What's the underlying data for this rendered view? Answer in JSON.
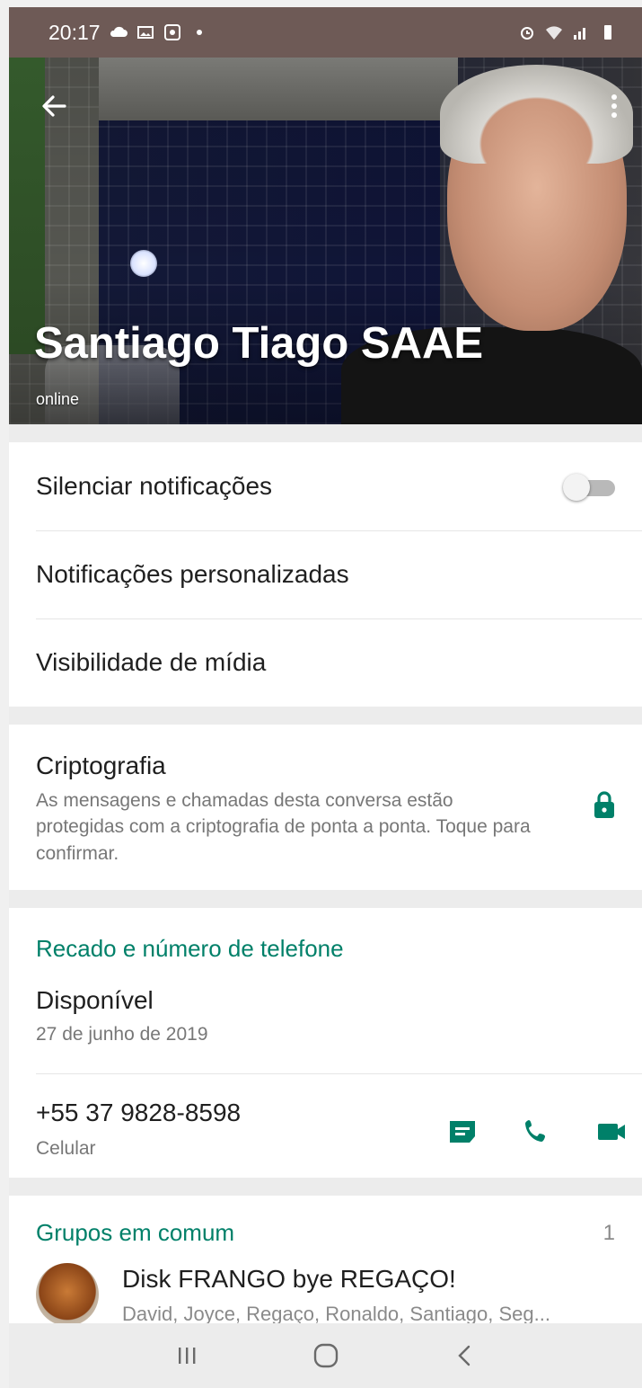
{
  "status_bar": {
    "time": "20:17"
  },
  "header": {
    "contact_name": "Santiago Tiago SAAE",
    "presence": "online"
  },
  "settings": {
    "mute_label": "Silenciar notificações",
    "mute_on": false,
    "custom_notifications_label": "Notificações personalizadas",
    "media_visibility_label": "Visibilidade de mídia"
  },
  "encryption": {
    "title": "Criptografia",
    "description": "As mensagens e chamadas desta conversa estão protegidas com a criptografia de ponta a ponta. Toque para confirmar."
  },
  "about": {
    "section_title": "Recado e número de telefone",
    "status": "Disponível",
    "status_date": "27 de junho de 2019",
    "phone": "+55 37 9828-8598",
    "phone_type": "Celular"
  },
  "groups": {
    "section_title": "Grupos em comum",
    "count": "1",
    "items": [
      {
        "name": "Disk FRANGO bye REGAÇO!",
        "members": "David, Joyce, Regaço, Ronaldo, Santiago, Seg..."
      }
    ]
  },
  "colors": {
    "accent": "#008069",
    "status_bar": "#6e5a56"
  },
  "icons": {
    "back": "arrow-left-icon",
    "more": "more-vertical-icon",
    "lock": "lock-icon",
    "message": "message-icon",
    "call": "phone-icon",
    "video": "video-icon"
  }
}
